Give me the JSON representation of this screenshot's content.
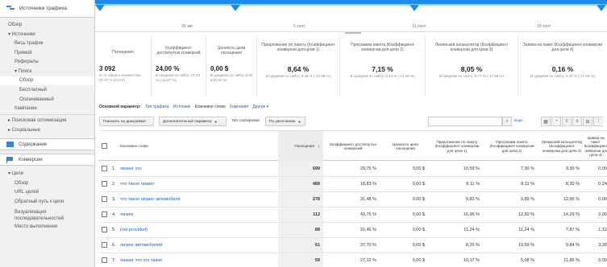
{
  "sidebar": {
    "header": "Источники трафика",
    "items": [
      {
        "label": "Обзор",
        "level": 1
      },
      {
        "label": "▾ Источники",
        "level": 1
      },
      {
        "label": "Весь трафик",
        "level": 2
      },
      {
        "label": "Прямой",
        "level": 2
      },
      {
        "label": "Рефералы",
        "level": 2
      },
      {
        "label": "▾ Поиск",
        "level": 2
      },
      {
        "label": "Обзор",
        "level": 3
      },
      {
        "label": "Бесплатный",
        "level": 3
      },
      {
        "label": "Оплачиваемый",
        "level": 3
      },
      {
        "label": "Кампании",
        "level": 2
      },
      {
        "label": "▸ Поисковая оптимизация",
        "level": 1
      },
      {
        "label": "▸ Социальные",
        "level": 1
      }
    ],
    "sections": [
      {
        "label": "Содержание"
      },
      {
        "label": "Конверсии"
      }
    ],
    "goals": [
      {
        "label": "▾ Цели",
        "level": 1
      },
      {
        "label": "Обзор",
        "level": 2
      },
      {
        "label": "URL целей",
        "level": 2
      },
      {
        "label": "Обратный путь к цели",
        "level": 2
      },
      {
        "label": "Визуализация",
        "level": 2
      },
      {
        "label": "последовательностей",
        "level": 2
      },
      {
        "label": "Место выполнения",
        "level": 2
      }
    ]
  },
  "chart": {
    "dates": [
      "29 авг",
      "5 сент",
      "12 сент",
      "19 сент"
    ]
  },
  "metrics": [
    {
      "title": "Посещения",
      "value": "3 092",
      "sub": "% от общего количества: 37,37 % (8 274)"
    },
    {
      "title": "Коэффициент достигнутых конверсий",
      "value": "24,00 %",
      "sub": "В среднем по сайту: 27,23 % (-11,87 %)"
    },
    {
      "title": "Ценность цели посещения",
      "value": "0,00 $",
      "sub": "В среднем по сайту: 0,00 $ (0,00 %)"
    },
    {
      "title": "Предложение по пакету (Коэффициент конверсии для цели 1)",
      "value": "8,64 %",
      "sub": "В среднем по сайту: 9,38 % (-10,08 %)"
    },
    {
      "title": "Программа пакета (Коэффициент конверсии для цели 2)",
      "value": "7,15 %",
      "sub": "В среднем по сайту: 8,34 % (-14,25 %)"
    },
    {
      "title": "Ленинский калькулятор (Коэффициент конверсии для цели 3)",
      "value": "8,05 %",
      "sub": "В среднем по сайту: 9,77 % (-17,59 %)"
    },
    {
      "title": "Заявка на пакет (Коэффициент конверсии для цели 4)",
      "value": "0,16 %",
      "sub": "В среднем по сайту: 0,20 % (-17,45 %)"
    }
  ],
  "dimension": {
    "label": "Основной параметр:",
    "options": [
      "Тип трафика",
      "Источник",
      "Ключевое слово",
      "Кампания",
      "Другое ▾"
    ]
  },
  "toolbar": {
    "chart_btn": "Показать на диаграмме",
    "secondary_btn": "Дополнительный параметр",
    "sort_label": "Тип сортировки:",
    "sort_value": "По умолчанию",
    "advanced": "Ещё..."
  },
  "table": {
    "headers": [
      "Ключевое слово",
      "Посещения",
      "Коэффициент достигнутых конверсий",
      "Ценность цели посещения",
      "Предложение по пакету (Коэффициент конверсии для цели 1)",
      "Программа пакета (Коэффициент конверсии для цели 2)",
      "Ленинский калькулятор (Коэффициент конверсии для цели 3)",
      "Заявка на пакет (Коэффициент конверсии для цели 4)"
    ],
    "sort_arrow": "↓",
    "rows": [
      {
        "n": "1.",
        "kw": "лизинг это",
        "visits": "699",
        "cr": "29,75 %",
        "val": "0,00 $",
        "g1": "10,59 %",
        "g2": "7,30 %",
        "g3": "9,30 %",
        "g4": "0,00"
      },
      {
        "n": "2.",
        "kw": "что такое лизинг",
        "visits": "489",
        "cr": "18,83 %",
        "val": "0,00 $",
        "g1": "8,11 %",
        "g2": "8,11 %",
        "g3": "8,30 %",
        "g4": "0,24"
      },
      {
        "n": "3.",
        "kw": "что такое лизинг автомобиля",
        "visits": "278",
        "cr": "31,48 %",
        "val": "0,00 $",
        "g1": "9,83 %",
        "g2": "9,89 %",
        "g3": "12,95 %",
        "g4": "0,00"
      },
      {
        "n": "4.",
        "kw": "лизинг",
        "visits": "112",
        "cr": "43,75 %",
        "val": "0,00 $",
        "g1": "16,96 %",
        "g2": "12,50 %",
        "g3": "14,29 %",
        "g4": "0,00"
      },
      {
        "n": "5.",
        "kw": "(not provided)",
        "visits": "89",
        "cr": "31,46 %",
        "val": "0,00 $",
        "g1": "11,24 %",
        "g2": "11,24 %",
        "g3": "7,87 %",
        "g4": "1,12"
      },
      {
        "n": "6.",
        "kw": "лизинг автомобилей",
        "visits": "61",
        "cr": "37,70 %",
        "val": "0,00 $",
        "g1": "8,20 %",
        "g2": "19,59 %",
        "g3": "9,84 %",
        "g4": "3,28"
      },
      {
        "n": "7.",
        "kw": "лизинг что это такое",
        "visits": "59",
        "cr": "27,12 %",
        "val": "0,00 $",
        "g1": "10,17 %",
        "g2": "5,08 %",
        "g3": "11,86 %",
        "g4": "0,00"
      }
    ]
  }
}
